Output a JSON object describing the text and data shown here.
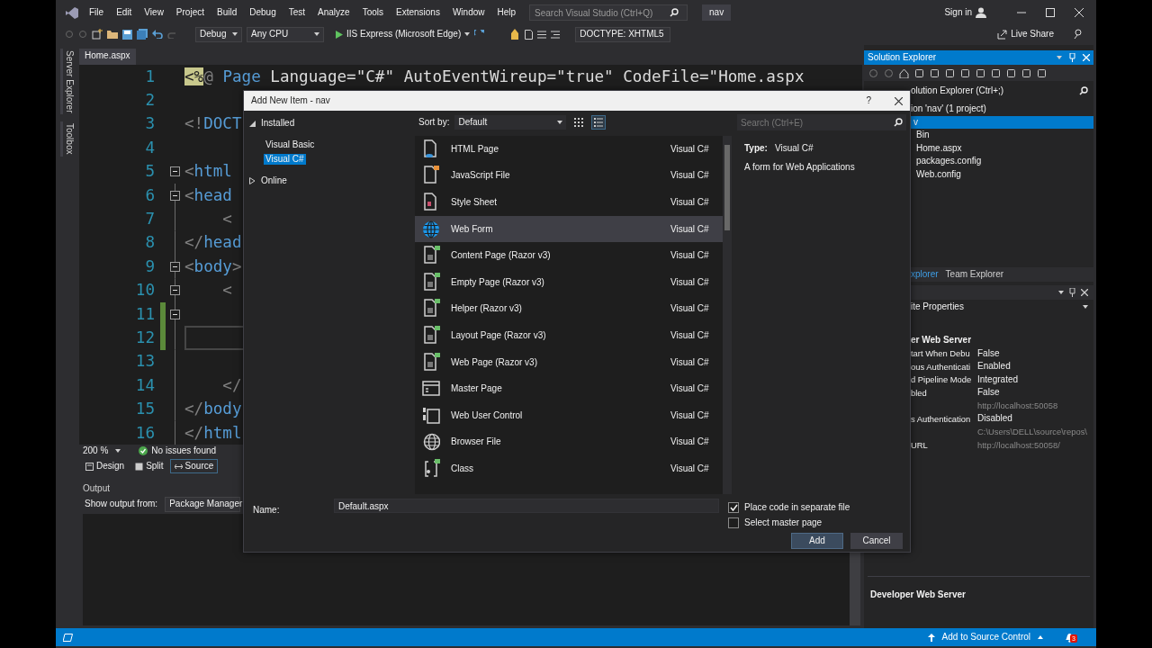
{
  "menu_bar": {
    "items": [
      "File",
      "Edit",
      "View",
      "Project",
      "Build",
      "Debug",
      "Test",
      "Analyze",
      "Tools",
      "Extensions",
      "Window",
      "Help"
    ],
    "search": {
      "placeholder": "Search Visual Studio (Ctrl+Q)"
    },
    "solution_name": "nav",
    "sign_in": "Sign in"
  },
  "toolbar": {
    "configuration": "Debug",
    "platform": "Any CPU",
    "run_target": "IIS Express (Microsoft Edge)",
    "doctype": "DOCTYPE: XHTML5",
    "live_share": "Live Share"
  },
  "side_tabs": [
    "Server Explorer",
    "Toolbox"
  ],
  "editor": {
    "tabs": [
      {
        "label": "Home.aspx",
        "selected": true
      }
    ],
    "lines": [
      {
        "number": "1",
        "foldable": false,
        "changed": false,
        "current": false,
        "segments": [
          {
            "text": "<%",
            "kind": "directive"
          },
          {
            "text": "@ ",
            "kind": "punct"
          },
          {
            "text": "Page",
            "kind": "tag"
          },
          {
            "text": " Language=\"C#\" AutoEventWireup=\"true\" CodeFile=\"Home.aspx",
            "kind": "text"
          }
        ]
      },
      {
        "number": "2",
        "foldable": false,
        "changed": false,
        "current": false
      },
      {
        "number": "3",
        "foldable": false,
        "changed": false,
        "current": false,
        "segments": [
          {
            "text": "<!",
            "kind": "punct"
          },
          {
            "text": "DOCT",
            "kind": "tag"
          }
        ]
      },
      {
        "number": "4",
        "foldable": false,
        "changed": false,
        "current": false
      },
      {
        "number": "5",
        "foldable": true,
        "changed": false,
        "current": false,
        "segments": [
          {
            "text": "<",
            "kind": "punct"
          },
          {
            "text": "html",
            "kind": "tag"
          }
        ]
      },
      {
        "number": "6",
        "foldable": true,
        "changed": false,
        "current": false,
        "segments": [
          {
            "text": "<",
            "kind": "punct"
          },
          {
            "text": "head",
            "kind": "tag"
          }
        ]
      },
      {
        "number": "7",
        "foldable": false,
        "changed": false,
        "current": false,
        "segments": [
          {
            "text": "    <",
            "kind": "punct"
          }
        ]
      },
      {
        "number": "8",
        "foldable": false,
        "changed": false,
        "current": false,
        "segments": [
          {
            "text": "</",
            "kind": "punct"
          },
          {
            "text": "head",
            "kind": "tag"
          }
        ]
      },
      {
        "number": "9",
        "foldable": true,
        "changed": false,
        "current": false,
        "segments": [
          {
            "text": "<",
            "kind": "punct"
          },
          {
            "text": "body",
            "kind": "tag"
          },
          {
            "text": ">",
            "kind": "punct"
          }
        ]
      },
      {
        "number": "10",
        "foldable": true,
        "changed": false,
        "current": false,
        "segments": [
          {
            "text": "    <",
            "kind": "punct"
          }
        ]
      },
      {
        "number": "11",
        "foldable": true,
        "changed": true,
        "current": false
      },
      {
        "number": "12",
        "foldable": false,
        "changed": true,
        "current": true
      },
      {
        "number": "13",
        "foldable": false,
        "changed": false,
        "current": false
      },
      {
        "number": "14",
        "foldable": false,
        "changed": false,
        "current": false,
        "segments": [
          {
            "text": "    </",
            "kind": "punct"
          }
        ]
      },
      {
        "number": "15",
        "foldable": false,
        "changed": false,
        "current": false,
        "segments": [
          {
            "text": "</",
            "kind": "punct"
          },
          {
            "text": "body",
            "kind": "tag"
          }
        ]
      },
      {
        "number": "16",
        "foldable": false,
        "changed": false,
        "current": false,
        "segments": [
          {
            "text": "</",
            "kind": "punct"
          },
          {
            "text": "html",
            "kind": "tag"
          }
        ]
      }
    ],
    "zoom": "200 %",
    "issues": "No issues found",
    "view_tabs": [
      {
        "label": "Design",
        "kind": "design",
        "selected": false
      },
      {
        "label": "Split",
        "kind": "split",
        "selected": false
      },
      {
        "label": "Source",
        "kind": "source",
        "selected": true
      }
    ]
  },
  "output": {
    "title": "Output",
    "show_from_label": "Show output from:",
    "source": "Package Manager"
  },
  "solution_explorer": {
    "title": "Solution Explorer",
    "search": "olution Explorer (Ctrl+;)",
    "tree": [
      {
        "label": "ion 'nav' (1 project)",
        "selected": false,
        "children": [
          {
            "label": "v",
            "selected": true,
            "children": [
              {
                "label": "Bin",
                "selected": false
              },
              {
                "label": "Home.aspx",
                "selected": false
              },
              {
                "label": "packages.config",
                "selected": false
              },
              {
                "label": "Web.config",
                "selected": false
              }
            ]
          }
        ]
      }
    ]
  },
  "panel_tabs": [
    {
      "label": "xplorer",
      "selected": true
    },
    {
      "label": "Team Explorer",
      "selected": false
    }
  ],
  "properties": {
    "object": "ite Properties",
    "category": "er Web Server",
    "rows": [
      {
        "name": "tart When Debu",
        "value": "False",
        "read_only": false
      },
      {
        "name": "ous Authenticati",
        "value": "Enabled",
        "read_only": false
      },
      {
        "name": "d Pipeline Mode",
        "value": "Integrated",
        "read_only": false
      },
      {
        "name": "bled",
        "value": "False",
        "read_only": false
      },
      {
        "value": "http://localhost:50058",
        "read_only": true
      },
      {
        "name": "s Authentication",
        "value": "Disabled",
        "read_only": false
      },
      {
        "value": "C:\\Users\\DELL\\source\\repos\\",
        "read_only": true
      },
      {
        "name": "URL",
        "value": "http://localhost:50058/",
        "read_only": true
      }
    ],
    "description_title": "Developer Web Server"
  },
  "dialog": {
    "title": "Add New Item - nav",
    "help": "?",
    "tree": [
      {
        "label": "Installed",
        "expanded": true,
        "selected": false,
        "children": [
          {
            "label": "Visual Basic",
            "selected": false
          },
          {
            "label": "Visual C#",
            "selected": true
          }
        ]
      },
      {
        "label": "Online",
        "expanded": false,
        "selected": false
      }
    ],
    "sort_label": "Sort by:",
    "sort_value": "Default",
    "view_modes": [
      {
        "kind": "grid",
        "selected": false
      },
      {
        "kind": "list",
        "selected": true
      }
    ],
    "templates": [
      {
        "name": "HTML Page",
        "language": "Visual C#",
        "kind": "html",
        "selected": false
      },
      {
        "name": "JavaScript File",
        "language": "Visual C#",
        "kind": "js",
        "selected": false
      },
      {
        "name": "Style Sheet",
        "language": "Visual C#",
        "kind": "css",
        "selected": false
      },
      {
        "name": "Web Form",
        "language": "Visual C#",
        "kind": "globe",
        "selected": true
      },
      {
        "name": "Content Page (Razor v3)",
        "language": "Visual C#",
        "kind": "razor",
        "selected": false
      },
      {
        "name": "Empty Page (Razor v3)",
        "language": "Visual C#",
        "kind": "razor",
        "selected": false
      },
      {
        "name": "Helper (Razor v3)",
        "language": "Visual C#",
        "kind": "razor",
        "selected": false
      },
      {
        "name": "Layout Page (Razor v3)",
        "language": "Visual C#",
        "kind": "razor",
        "selected": false
      },
      {
        "name": "Web Page (Razor v3)",
        "language": "Visual C#",
        "kind": "razor",
        "selected": false
      },
      {
        "name": "Master Page",
        "language": "Visual C#",
        "kind": "master",
        "selected": false
      },
      {
        "name": "Web User Control",
        "language": "Visual C#",
        "kind": "control",
        "selected": false
      },
      {
        "name": "Browser File",
        "language": "Visual C#",
        "kind": "browser",
        "selected": false
      },
      {
        "name": "Class",
        "language": "Visual C#",
        "kind": "class",
        "selected": false
      }
    ],
    "search": {
      "placeholder": "Search (Ctrl+E)"
    },
    "details": {
      "type_label": "Type:",
      "type_value": "Visual C#",
      "description": "A form for Web Applications"
    },
    "name_label": "Name:",
    "name_value": "Default.aspx",
    "options": [
      {
        "label": "Place code in separate file",
        "checked": true
      },
      {
        "label": "Select master page",
        "checked": false
      }
    ],
    "buttons": [
      {
        "label": "Add",
        "kind": "primary"
      },
      {
        "label": "Cancel",
        "kind": "secondary"
      }
    ]
  },
  "status_bar": {
    "source_control": "Add to Source Control",
    "notifications": "3"
  }
}
